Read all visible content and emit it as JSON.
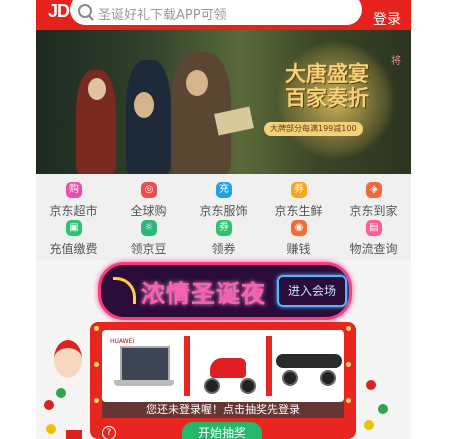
{
  "header": {
    "logo_text": "JD",
    "search_placeholder": "圣诞好礼下载APP可领",
    "login_label": "登录"
  },
  "banner": {
    "title_line1": "大唐盛宴",
    "title_line2": "百家奏折",
    "subtitle": "大牌部分每满199减100",
    "corner_text": "将",
    "slide_count": 4,
    "active_slide": 1
  },
  "nav_grid": [
    {
      "label": "京东超市",
      "icon": "shopping-cart-icon",
      "color": "#e94cab",
      "glyph": "购"
    },
    {
      "label": "全球购",
      "icon": "global-icon",
      "color": "#f04a4a",
      "glyph": "◎"
    },
    {
      "label": "京东服饰",
      "icon": "clothing-icon",
      "color": "#1ea1e8",
      "glyph": "充"
    },
    {
      "label": "京东生鲜",
      "icon": "fresh-icon",
      "color": "#f7a51d",
      "glyph": "券"
    },
    {
      "label": "京东到家",
      "icon": "home-delivery-icon",
      "color": "#f4683a",
      "glyph": "◈"
    },
    {
      "label": "充值缴费",
      "icon": "recharge-icon",
      "color": "#29c46e",
      "glyph": "▣"
    },
    {
      "label": "领京豆",
      "icon": "jd-bean-icon",
      "color": "#2bb87a",
      "glyph": "☼"
    },
    {
      "label": "领券",
      "icon": "coupon-icon",
      "color": "#2fc06c",
      "glyph": "券"
    },
    {
      "label": "赚钱",
      "icon": "money-icon",
      "color": "#f66b2f",
      "glyph": "◉"
    },
    {
      "label": "物流查询",
      "icon": "logistics-icon",
      "color": "#ff5e8f",
      "glyph": "▤"
    }
  ],
  "promo": {
    "neon_title": "浓情圣诞夜",
    "enter_label": "进入会场",
    "login_message": "您还未登录喔！点击抽奖先登录",
    "start_label": "开始抽奖",
    "help_glyph": "?",
    "brand_mark": "HUAWEI"
  }
}
